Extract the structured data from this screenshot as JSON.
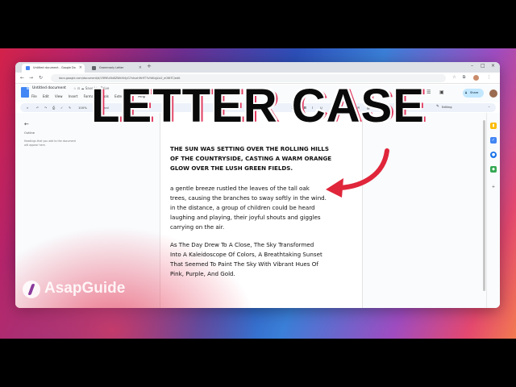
{
  "browser": {
    "tabs": [
      {
        "label": "Untitled document - Google Do"
      },
      {
        "label": "Grammarly Letter"
      }
    ],
    "address": "docs.google.com/document/d/1Rf9Ez5bBZWkHl4yG7ntvxhMr9T7sYdKqjLlx2_eO6tTC/edit"
  },
  "docs": {
    "title": "Untitled document",
    "title_status": "☆  ⊡  ☁  Saved to Drive",
    "menu": [
      "File",
      "Edit",
      "View",
      "Insert",
      "Format",
      "Tools",
      "Extensions",
      "Help"
    ],
    "share_label": "Share",
    "editing_label": "Editing",
    "toolbar": {
      "zoom": "100%",
      "font": "Normal",
      "size": "11"
    }
  },
  "outline": {
    "title": "Outline",
    "hint": "Headings that you add to the document will appear here."
  },
  "document": {
    "para1": [
      "THE SUN WAS SETTING OVER THE ROLLING HILLS",
      "OF THE COUNTRYSIDE, CASTING A WARM ORANGE",
      "GLOW OVER THE LUSH GREEN FIELDS."
    ],
    "para2": [
      "a gentle breeze rustled the leaves of the tall oak",
      "trees, causing the branches to sway softly in the wind.",
      "in the distance, a group of children could be heard",
      "laughing and playing, their joyful shouts and giggles",
      "carrying on the air."
    ],
    "para3": [
      "As The Day Drew To A Close, The Sky Transformed",
      "Into A Kaleidoscope Of Colors, A Breathtaking Sunset",
      "That Seemed To Paint The Sky With Vibrant Hues Of",
      "Pink, Purple, And Gold."
    ]
  },
  "overlay": {
    "headline": "LETTER CASE",
    "brand": "AsapGuide",
    "arrow_color": "#e0263b"
  },
  "colors": {
    "accent": "#4285f4",
    "share_bg": "#c2e7ff"
  }
}
